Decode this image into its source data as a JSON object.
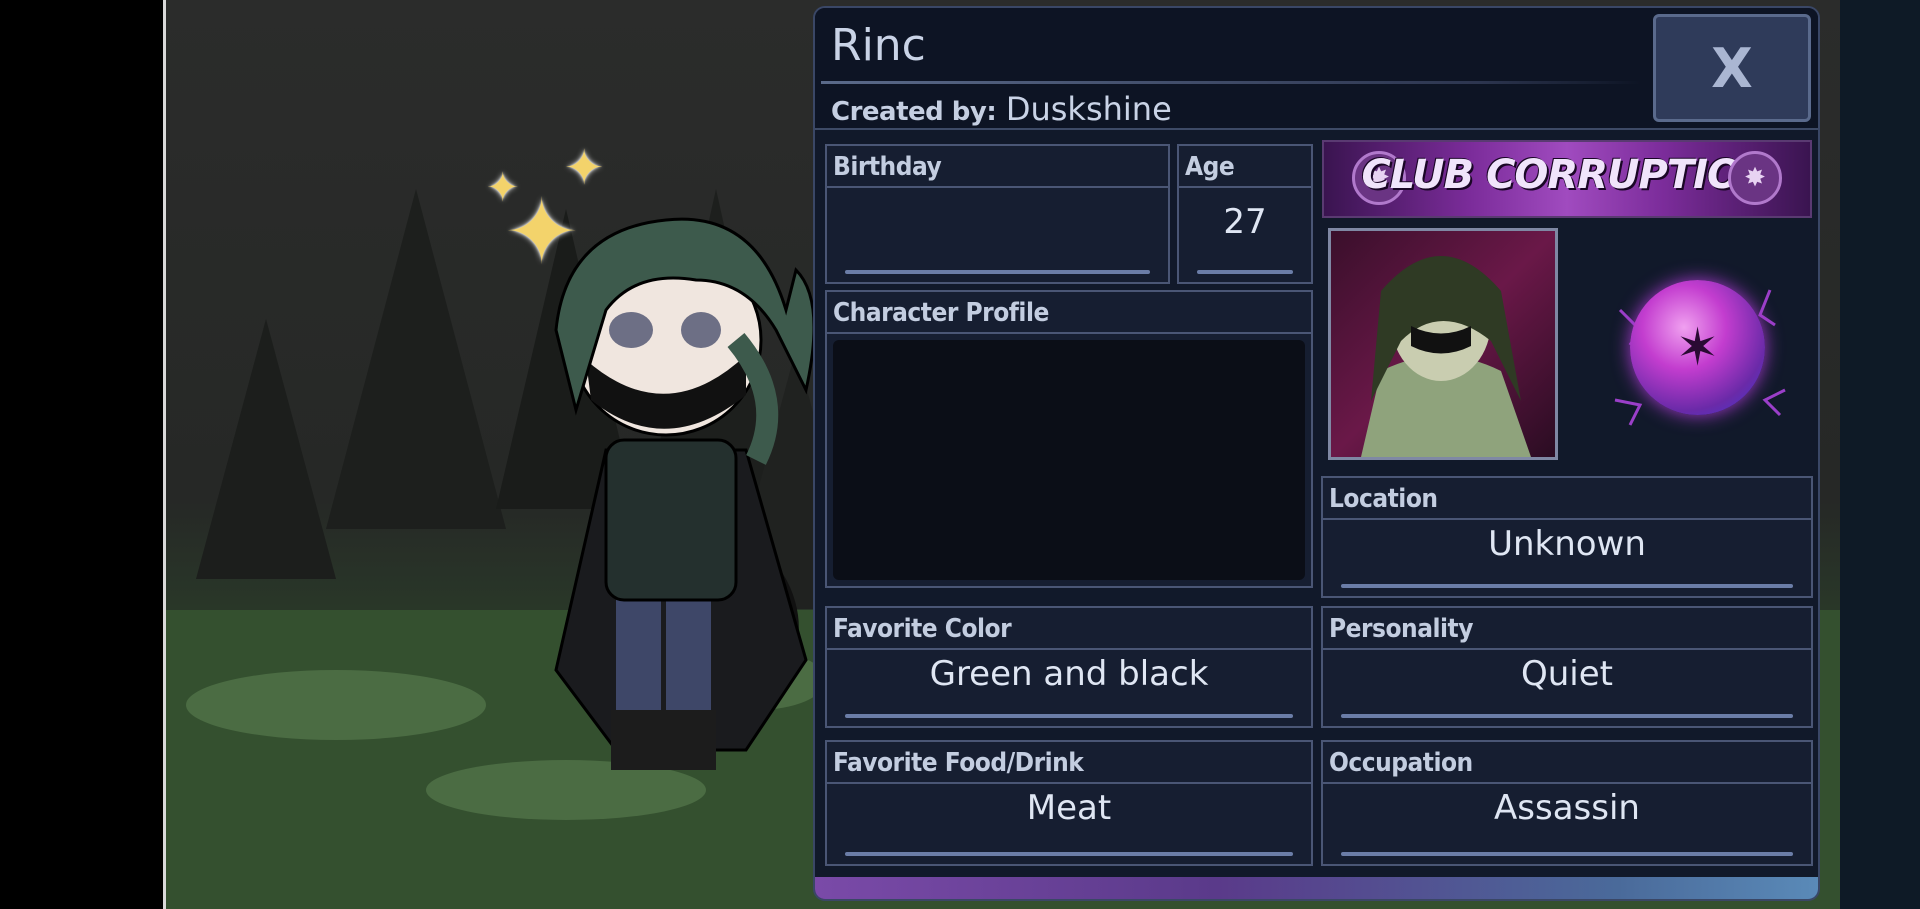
{
  "character": {
    "name": "Rinc",
    "created_by_label": "Created by:",
    "created_by": "Duskshine"
  },
  "close_button": {
    "label": "X"
  },
  "fields": {
    "birthday": {
      "label": "Birthday",
      "value": ""
    },
    "age": {
      "label": "Age",
      "value": "27"
    },
    "character_profile": {
      "label": "Character Profile",
      "value": ""
    },
    "location": {
      "label": "Location",
      "value": "Unknown"
    },
    "favorite_color": {
      "label": "Favorite Color",
      "value": "Green and black"
    },
    "personality": {
      "label": "Personality",
      "value": "Quiet"
    },
    "favorite_food": {
      "label": "Favorite Food/Drink",
      "value": "Meat"
    },
    "occupation": {
      "label": "Occupation",
      "value": "Assassin"
    }
  },
  "club": {
    "name": "CLUB CORRUPTION"
  },
  "icons": {
    "close": "close-icon",
    "club_emblem": "club-emblem-icon",
    "orb": "corruption-orb-icon",
    "sparkle": "sparkle-icon"
  },
  "colors": {
    "panel_bg": "#11192a",
    "panel_border": "#3a4766",
    "accent_purple": "#a04bbf",
    "value_line": "#6b7da7"
  }
}
